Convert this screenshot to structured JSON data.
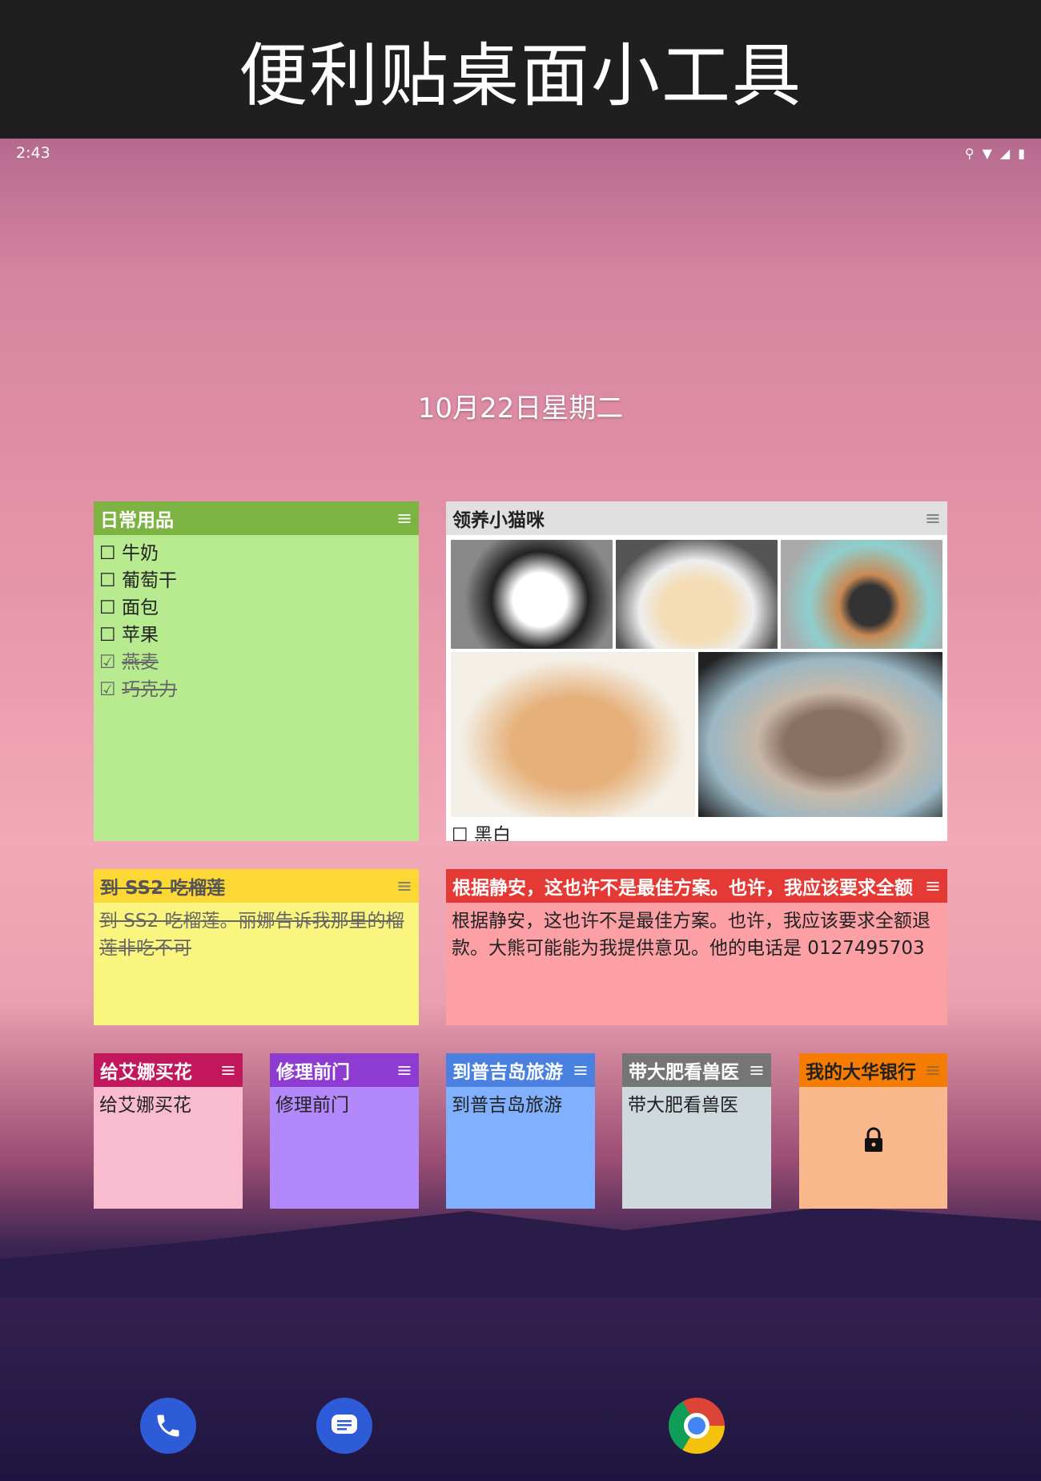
{
  "banner": {
    "title": "便利贴桌面小工具"
  },
  "status_bar": {
    "time": "2:43",
    "icons": [
      "location-icon",
      "wifi-icon",
      "signal-icon",
      "battery-icon"
    ]
  },
  "date": "10月22日星期二",
  "notes": {
    "groceries": {
      "title": "日常用品",
      "header_color": "#7cb342",
      "body_color": "#b8eb8f",
      "items": [
        {
          "label": "牛奶",
          "checked": false,
          "box": "☐"
        },
        {
          "label": "葡萄干",
          "checked": false,
          "box": "☐"
        },
        {
          "label": "面包",
          "checked": false,
          "box": "☐"
        },
        {
          "label": "苹果",
          "checked": false,
          "box": "☐"
        },
        {
          "label": "燕麦",
          "checked": true,
          "box": "☑"
        },
        {
          "label": "巧克力",
          "checked": true,
          "box": "☑"
        }
      ]
    },
    "kittens": {
      "title": "领养小猫咪",
      "header_color": "#e0e0e0",
      "body_color": "#ffffff",
      "photos": [
        "kitten-black-white",
        "kitten-cream",
        "kitten-calico",
        "kitten-orange",
        "kitten-tabby"
      ],
      "item_box": "☐",
      "item": "黑白"
    },
    "durian": {
      "title": "到 SS2 吃榴莲",
      "header_color": "#fdd835",
      "body_color": "#f9f57f",
      "body": "到 SS2 吃榴莲。丽娜告诉我那里的榴莲非吃不可"
    },
    "refund": {
      "title": "根据静安，这也许不是最佳方案。也许，我应该要求全额",
      "header_color": "#e53935",
      "body_color": "#fca0a6",
      "body": "根据静安，这也许不是最佳方案。也许，我应该要求全额退款。大熊可能能为我提供意见。他的电话是 0127495703"
    },
    "flowers": {
      "title": "给艾娜买花",
      "header_color": "#c2185b",
      "body_color": "#f8bbd0",
      "body": "给艾娜买花"
    },
    "door": {
      "title": "修理前门",
      "header_color": "#8e3bd1",
      "body_color": "#b388fa",
      "body": "修理前门"
    },
    "phuket": {
      "title": "到普吉岛旅游",
      "header_color": "#4a80e0",
      "body_color": "#80b0ff",
      "body": "到普吉岛旅游"
    },
    "vet": {
      "title": "带大肥看兽医",
      "header_color": "#757575",
      "body_color": "#cfd8dc",
      "body": "带大肥看兽医"
    },
    "bank": {
      "title": "我的大华银行",
      "header_color": "#f57c00",
      "body_color": "#f8b88b",
      "locked": true
    }
  },
  "menu_icon": "≡",
  "dock": [
    {
      "name": "phone-icon",
      "color": "#2e5bd8"
    },
    {
      "name": "messages-icon",
      "color": "#2e5bd8"
    },
    {
      "name": "chrome-icon",
      "color": "#ffffff"
    }
  ]
}
